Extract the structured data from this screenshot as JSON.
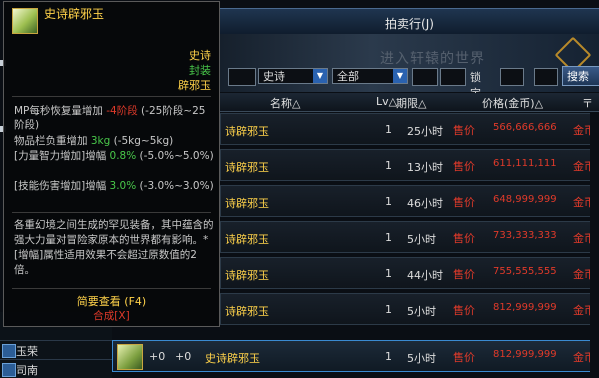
{
  "window": {
    "title": "拍卖行(J)",
    "banner_text": "进入轩辕的世界"
  },
  "filter": {
    "rarity": "史诗",
    "category": "全部",
    "label_lock": "锁定",
    "search_label": "搜索"
  },
  "columns": {
    "name": "名称△",
    "lv": "Lv△",
    "duration": "期限△",
    "price": "价格(金币)△",
    "tag": "〒"
  },
  "rows": [
    {
      "name": "诗辟邪玉",
      "lv": "1",
      "duration": "25小时",
      "sale": "售价",
      "price": "566,666,666",
      "coin": "金币"
    },
    {
      "name": "诗辟邪玉",
      "lv": "1",
      "duration": "13小时",
      "sale": "售价",
      "price": "611,111,111",
      "coin": "金币"
    },
    {
      "name": "诗辟邪玉",
      "lv": "1",
      "duration": "46小时",
      "sale": "售价",
      "price": "648,999,999",
      "coin": "金币"
    },
    {
      "name": "诗辟邪玉",
      "lv": "1",
      "duration": "5小时",
      "sale": "售价",
      "price": "733,333,333",
      "coin": "金币"
    },
    {
      "name": "诗辟邪玉",
      "lv": "1",
      "duration": "44小时",
      "sale": "售价",
      "price": "755,555,555",
      "coin": "金币"
    },
    {
      "name": "诗辟邪玉",
      "lv": "1",
      "duration": "5小时",
      "sale": "售价",
      "price": "812,999,999",
      "coin": "金币"
    },
    {
      "name": "史诗辟邪玉",
      "plus1": "+0",
      "plus2": "+0",
      "lv": "1",
      "duration": "5小时",
      "sale": "售价",
      "price": "812,999,999",
      "coin": "金币"
    }
  ],
  "left_list": [
    {
      "label": "玉荣"
    },
    {
      "label": "司南"
    }
  ],
  "tooltip": {
    "name": "史诗辟邪玉",
    "rarity": "史诗",
    "seal": "封装",
    "type": "辟邪玉",
    "stat1_a": "MP每秒恢复量增加 ",
    "stat1_b": "-4阶段",
    "stat1_c": " (-25阶段~25阶段)",
    "stat2_a": "物品栏负重增加 ",
    "stat2_b": "3kg",
    "stat2_c": " (-5kg~5kg)",
    "stat3_a": "[力量智力增加]增幅 ",
    "stat3_b": "0.8%",
    "stat3_c": " (-5.0%~5.0%)",
    "stat4_a": "[技能伤害增加]增幅 ",
    "stat4_b": "3.0%",
    "stat4_c": " (-3.0%~3.0%)",
    "description": "各重幻境之间生成的罕见装备，其中蕴含的强大力量对冒险家原本的世界都有影响。*[增幅]属性适用效果不会超过原数值的2倍。",
    "footer_view": "简要查看 (F4)",
    "footer_synth": "合成[X]"
  }
}
